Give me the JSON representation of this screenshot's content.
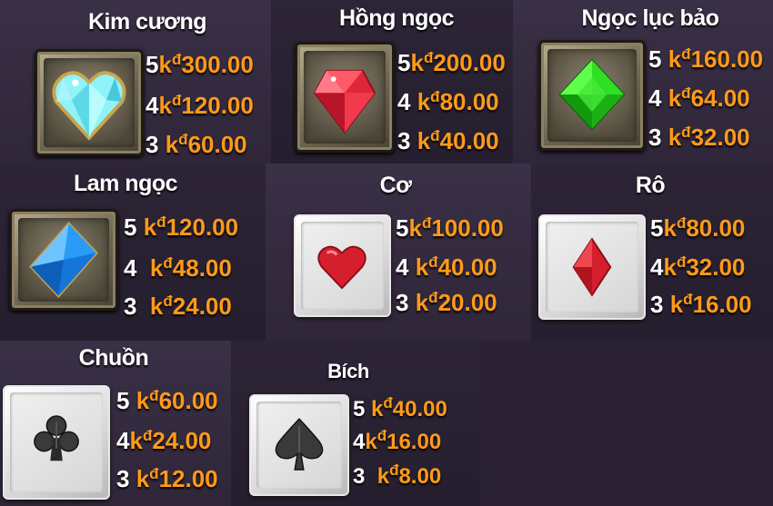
{
  "currency": {
    "k": "k",
    "d": "đ"
  },
  "symbols": [
    {
      "name": "Kim cương",
      "icon": "diamond-heart-gem-icon",
      "pays": [
        {
          "count": "5",
          "amount": "300.00"
        },
        {
          "count": "4",
          "amount": "120.00"
        },
        {
          "count": "3",
          "amount": "60.00"
        }
      ]
    },
    {
      "name": "Hồng ngọc",
      "icon": "ruby-gem-icon",
      "pays": [
        {
          "count": "5",
          "amount": "200.00"
        },
        {
          "count": "4",
          "amount": "80.00"
        },
        {
          "count": "3",
          "amount": "40.00"
        }
      ]
    },
    {
      "name": "Ngọc lục bảo",
      "icon": "emerald-gem-icon",
      "pays": [
        {
          "count": "5",
          "amount": "160.00"
        },
        {
          "count": "4",
          "amount": "64.00"
        },
        {
          "count": "3",
          "amount": "32.00"
        }
      ]
    },
    {
      "name": "Lam ngọc",
      "icon": "sapphire-gem-icon",
      "pays": [
        {
          "count": "5",
          "amount": "120.00"
        },
        {
          "count": "4",
          "amount": "48.00"
        },
        {
          "count": "3",
          "amount": "24.00"
        }
      ]
    },
    {
      "name": "Cơ",
      "icon": "heart-suit-icon",
      "pays": [
        {
          "count": "5",
          "amount": "100.00"
        },
        {
          "count": "4",
          "amount": "40.00"
        },
        {
          "count": "3",
          "amount": "20.00"
        }
      ]
    },
    {
      "name": "Rô",
      "icon": "diamond-suit-icon",
      "pays": [
        {
          "count": "5",
          "amount": "80.00"
        },
        {
          "count": "4",
          "amount": "32.00"
        },
        {
          "count": "3",
          "amount": "16.00"
        }
      ]
    },
    {
      "name": "Chuồn",
      "icon": "club-suit-icon",
      "pays": [
        {
          "count": "5",
          "amount": "60.00"
        },
        {
          "count": "4",
          "amount": "24.00"
        },
        {
          "count": "3",
          "amount": "12.00"
        }
      ]
    },
    {
      "name": "Bích",
      "icon": "spade-suit-icon",
      "pays": [
        {
          "count": "5",
          "amount": "40.00"
        },
        {
          "count": "4",
          "amount": "16.00"
        },
        {
          "count": "3",
          "amount": "8.00"
        }
      ]
    }
  ]
}
